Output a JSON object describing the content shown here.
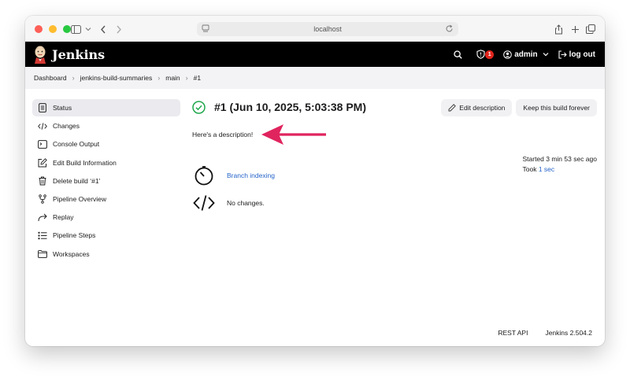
{
  "browser": {
    "url": "localhost"
  },
  "header": {
    "brand": "Jenkins",
    "security_count": "1",
    "user": "admin",
    "logout": "log out"
  },
  "breadcrumbs": [
    "Dashboard",
    "jenkins-build-summaries",
    "main",
    "#1"
  ],
  "sidebar": {
    "items": [
      {
        "label": "Status",
        "icon": "status-icon"
      },
      {
        "label": "Changes",
        "icon": "code-icon"
      },
      {
        "label": "Console Output",
        "icon": "terminal-icon"
      },
      {
        "label": "Edit Build Information",
        "icon": "edit-icon"
      },
      {
        "label": "Delete build ‘#1’",
        "icon": "trash-icon"
      },
      {
        "label": "Pipeline Overview",
        "icon": "branch-icon"
      },
      {
        "label": "Replay",
        "icon": "replay-icon"
      },
      {
        "label": "Pipeline Steps",
        "icon": "list-icon"
      },
      {
        "label": "Workspaces",
        "icon": "folder-icon"
      }
    ]
  },
  "main": {
    "title": "#1 (Jun 10, 2025, 5:03:38 PM)",
    "edit_description": "Edit description",
    "keep_forever": "Keep this build forever",
    "description": "Here's a description!",
    "cause_link": "Branch indexing",
    "changes_text": "No changes.",
    "started": "Started 3 min 53 sec ago",
    "took_prefix": "Took",
    "took_value": "1 sec"
  },
  "footer": {
    "rest_api": "REST API",
    "version": "Jenkins 2.504.2"
  },
  "colors": {
    "accent": "#2463c8",
    "success": "#1ea64b",
    "arrow": "#e0245e",
    "badge": "#e0241b"
  }
}
